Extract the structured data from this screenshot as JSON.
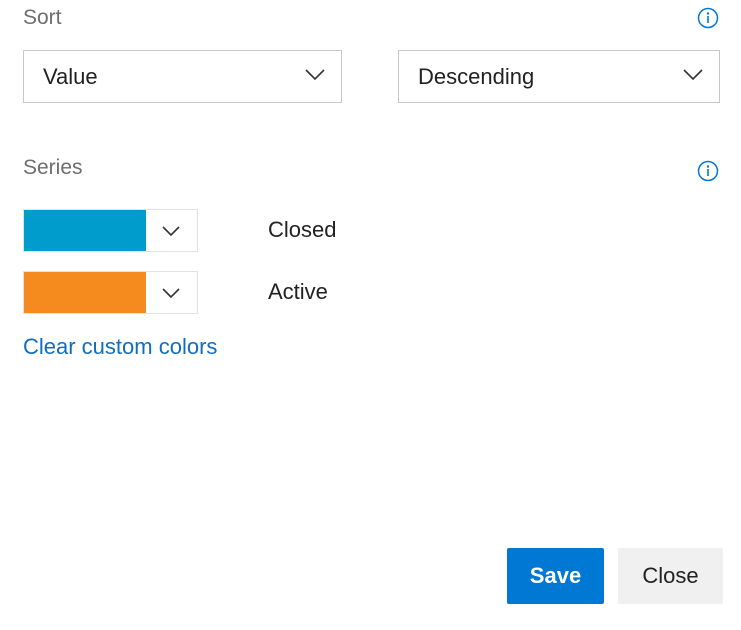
{
  "sort": {
    "label": "Sort",
    "field": {
      "value": "Value"
    },
    "direction": {
      "value": "Descending"
    }
  },
  "series": {
    "label": "Series",
    "items": [
      {
        "name": "Closed",
        "color": "#009ccc"
      },
      {
        "name": "Active",
        "color": "#f58b1f"
      }
    ],
    "clear_link": "Clear custom colors"
  },
  "footer": {
    "save_label": "Save",
    "close_label": "Close"
  },
  "icons": {
    "info": "info-icon",
    "chevron": "chevron-down-icon"
  },
  "accent_color": "#0078d4"
}
